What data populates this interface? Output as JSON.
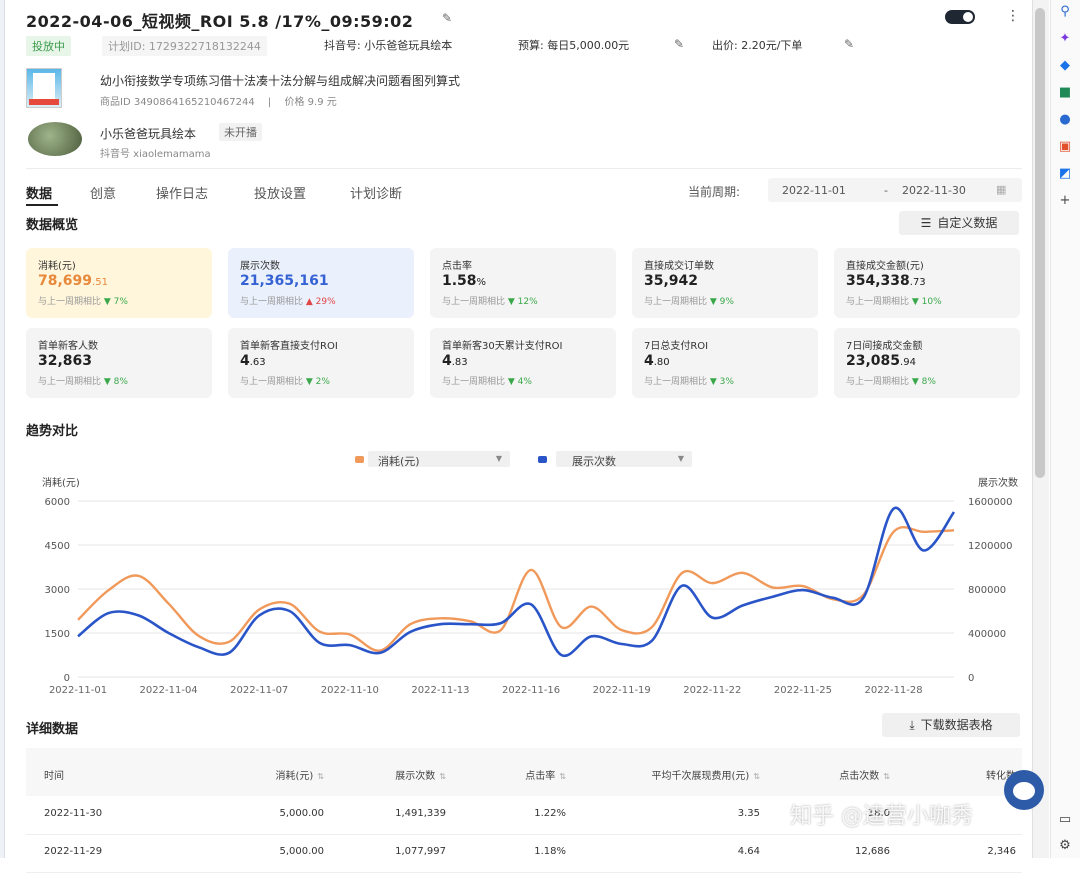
{
  "header": {
    "title": "2022-04-06_短视频_ROI 5.8 /17%_09:59:02",
    "status_tag": "投放中",
    "plan_id": "计划ID: 1729322718132244",
    "douyin_account": "抖音号: 小乐爸爸玩具绘本",
    "budget": "预算: 每日5,000.00元",
    "bid": "出价: 2.20元/下单"
  },
  "product": {
    "title": "幼小衔接数学专项练习借十法凑十法分解与组成解决问题看图列算式",
    "product_id": "商品ID 3490864165210467244",
    "separator": "|",
    "price": "价格 9.9 元"
  },
  "account": {
    "name": "小乐爸爸玩具绘本",
    "tag": "未开播",
    "handle": "抖音号 xiaolemamama"
  },
  "tabs": [
    "数据",
    "创意",
    "操作日志",
    "投放设置",
    "计划诊断"
  ],
  "period": {
    "label": "当前周期:",
    "start": "2022-11-01",
    "dash": "-",
    "end": "2022-11-30"
  },
  "overview": {
    "title": "数据概览",
    "custom_button": "自定义数据",
    "cards": [
      {
        "label": "消耗(元)",
        "value_main": "78,699",
        "value_dec": ".51",
        "compare": "与上一周期相比",
        "change": "7%",
        "dir": "down",
        "style": "yellow"
      },
      {
        "label": "展示次数",
        "value_main": "21,365,161",
        "value_dec": "",
        "compare": "与上一周期相比",
        "change": "29%",
        "dir": "up",
        "style": "blue"
      },
      {
        "label": "点击率",
        "value_main": "1.58",
        "value_dec": "%",
        "compare": "与上一周期相比",
        "change": "12%",
        "dir": "down",
        "style": "gray"
      },
      {
        "label": "直接成交订单数",
        "value_main": "35,942",
        "value_dec": "",
        "compare": "与上一周期相比",
        "change": "9%",
        "dir": "down",
        "style": "gray"
      },
      {
        "label": "直接成交金额(元)",
        "value_main": "354,338",
        "value_dec": ".73",
        "compare": "与上一周期相比",
        "change": "10%",
        "dir": "down",
        "style": "gray"
      },
      {
        "label": "首单新客人数",
        "value_main": "32,863",
        "value_dec": "",
        "compare": "与上一周期相比",
        "change": "8%",
        "dir": "down",
        "style": "gray"
      },
      {
        "label": "首单新客直接支付ROI",
        "value_main": "4",
        "value_dec": ".63",
        "compare": "与上一周期相比",
        "change": "2%",
        "dir": "down",
        "style": "gray"
      },
      {
        "label": "首单新客30天累计支付ROI",
        "value_main": "4",
        "value_dec": ".83",
        "compare": "与上一周期相比",
        "change": "4%",
        "dir": "down",
        "style": "gray"
      },
      {
        "label": "7日总支付ROI",
        "value_main": "4",
        "value_dec": ".80",
        "compare": "与上一周期相比",
        "change": "3%",
        "dir": "down",
        "style": "gray"
      },
      {
        "label": "7日间接成交金额",
        "value_main": "23,085",
        "value_dec": ".94",
        "compare": "与上一周期相比",
        "change": "8%",
        "dir": "down",
        "style": "gray"
      }
    ]
  },
  "trend": {
    "title": "趋势对比",
    "legend": [
      {
        "name": "消耗(元)",
        "color": "#f0995a"
      },
      {
        "name": "展示次数",
        "color": "#2a55c8"
      }
    ]
  },
  "chart_data": {
    "type": "line",
    "x": [
      "2022-11-01",
      "2022-11-02",
      "2022-11-03",
      "2022-11-04",
      "2022-11-05",
      "2022-11-06",
      "2022-11-07",
      "2022-11-08",
      "2022-11-09",
      "2022-11-10",
      "2022-11-11",
      "2022-11-12",
      "2022-11-13",
      "2022-11-14",
      "2022-11-15",
      "2022-11-16",
      "2022-11-17",
      "2022-11-18",
      "2022-11-19",
      "2022-11-20",
      "2022-11-21",
      "2022-11-22",
      "2022-11-23",
      "2022-11-24",
      "2022-11-25",
      "2022-11-26",
      "2022-11-27",
      "2022-11-28",
      "2022-11-29",
      "2022-11-30"
    ],
    "x_ticks": [
      "2022-11-01",
      "2022-11-04",
      "2022-11-07",
      "2022-11-10",
      "2022-11-13",
      "2022-11-16",
      "2022-11-19",
      "2022-11-22",
      "2022-11-25",
      "2022-11-28"
    ],
    "series": [
      {
        "name": "消耗(元)",
        "axis": "left",
        "values": [
          1950,
          2950,
          3450,
          2500,
          1400,
          1200,
          2300,
          2500,
          1550,
          1450,
          900,
          1800,
          2000,
          1900,
          1600,
          3650,
          1700,
          2400,
          1600,
          1700,
          3550,
          3200,
          3550,
          3050,
          3100,
          2650,
          2800,
          4950,
          4950,
          5000
        ]
      },
      {
        "name": "展示次数",
        "axis": "right",
        "values": [
          370000,
          580000,
          560000,
          400000,
          270000,
          220000,
          560000,
          600000,
          310000,
          290000,
          220000,
          410000,
          480000,
          480000,
          490000,
          660000,
          200000,
          370000,
          300000,
          330000,
          830000,
          540000,
          650000,
          730000,
          790000,
          720000,
          720000,
          1530000,
          1150000,
          1500000
        ]
      }
    ],
    "ylabel_left": "消耗(元)",
    "ylabel_right": "展示次数",
    "ylim_left": [
      0,
      6000
    ],
    "yticks_left": [
      0,
      1500,
      3000,
      4500,
      6000
    ],
    "ylim_right": [
      0,
      1600000
    ],
    "yticks_right": [
      0,
      400000,
      800000,
      1200000,
      1600000
    ]
  },
  "details": {
    "title": "详细数据",
    "download_button": "下载数据表格",
    "columns": [
      "时间",
      "消耗(元)",
      "展示次数",
      "点击率",
      "平均千次展现费用(元)",
      "点击次数",
      "转化数"
    ],
    "rows": [
      [
        "2022-11-30",
        "5,000.00",
        "1,491,339",
        "1.22%",
        "3.35",
        "18,0",
        ""
      ],
      [
        "2022-11-29",
        "5,000.00",
        "1,077,997",
        "1.18%",
        "4.64",
        "12,686",
        "2,346"
      ]
    ]
  },
  "watermark": "知乎 @逵营小咖秀",
  "colors": {
    "accent_orange": "#e8883a",
    "accent_blue": "#3563d4",
    "down_green": "#3aa84a",
    "up_red": "#e14646"
  }
}
